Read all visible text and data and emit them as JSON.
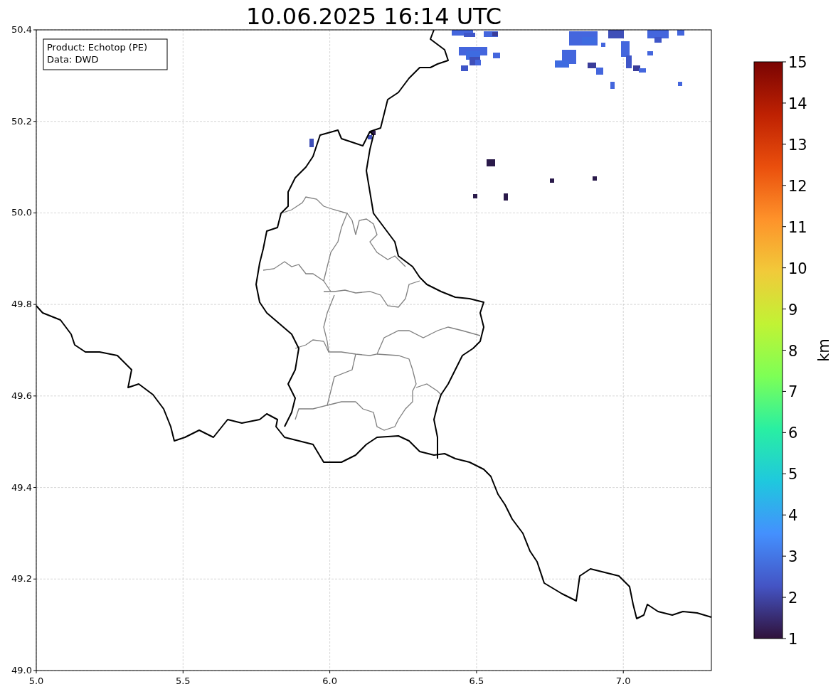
{
  "title": "10.06.2025 16:14 UTC",
  "info_box": [
    "Product: Echotop (PE)",
    "Data: DWD"
  ],
  "map": {
    "x_ticks": [
      "5.0",
      "5.5",
      "6.0",
      "6.5",
      "7.0"
    ],
    "y_ticks": [
      "50.4",
      "50.2",
      "50.0",
      "49.8",
      "49.6",
      "49.4",
      "49.2",
      "49.0"
    ]
  },
  "colorbar": {
    "label": "km",
    "ticks": [
      "15",
      "14",
      "13",
      "12",
      "11",
      "10",
      "9",
      "8",
      "7",
      "6",
      "5",
      "4",
      "3",
      "2",
      "1"
    ]
  }
}
